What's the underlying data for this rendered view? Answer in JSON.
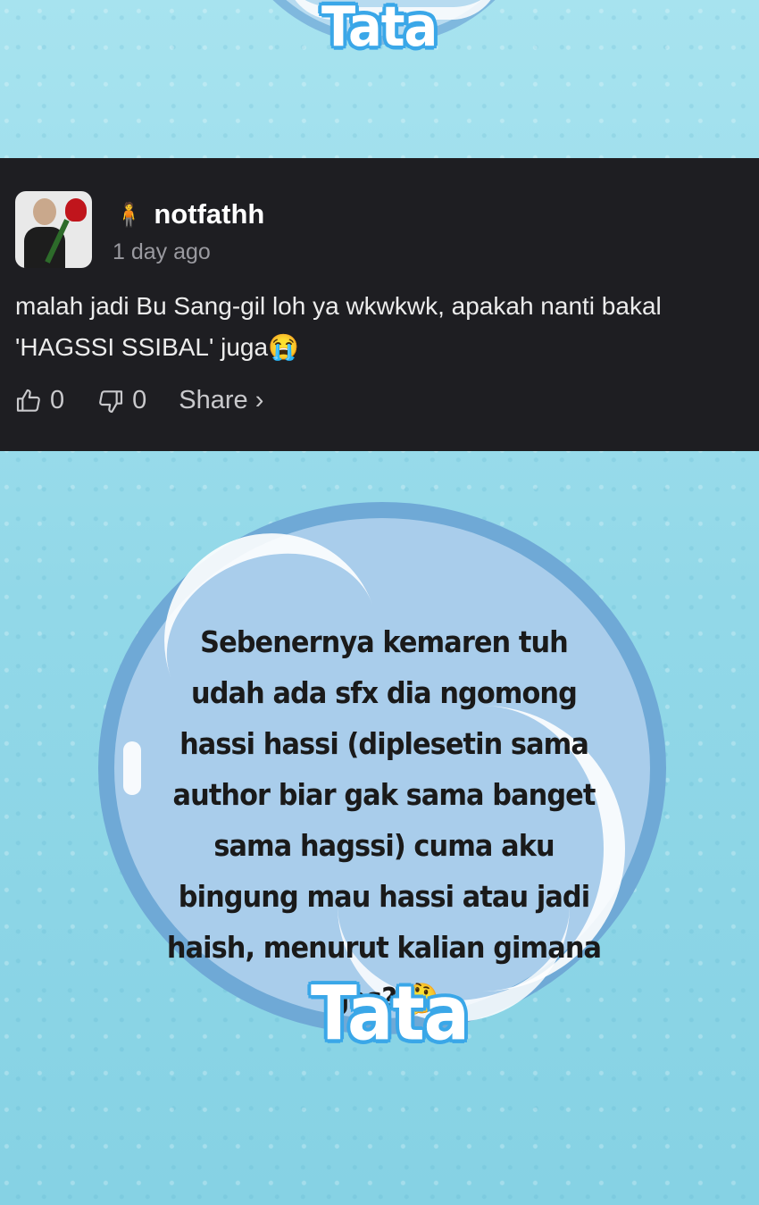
{
  "top_banner": {
    "watermark": "Tata"
  },
  "comment": {
    "user_emoji": "🧍",
    "username": "notfathh",
    "time": "1 day ago",
    "text": "malah jadi Bu Sang-gil loh ya wkwkwk, apakah nanti bakal 'HAGSSI SSIBAL' juga😭",
    "likes": "0",
    "dislikes": "0",
    "share_label": "Share ›"
  },
  "post": {
    "text": "Sebenernya kemaren tuh udah ada sfx dia ngomong hassi hassi (diplesetin sama author biar gak sama banget sama hagssi) cuma aku bingung mau hassi atau jadi haish, menurut kalian gimana ges? 🤔",
    "watermark": "Tata"
  },
  "icons": [
    "thumbs-up-icon",
    "thumbs-down-icon"
  ],
  "colors": {
    "card_bg": "#1e1e22",
    "circle_border": "#6fa9d6",
    "watermark_outline": "#3aa7e8"
  }
}
